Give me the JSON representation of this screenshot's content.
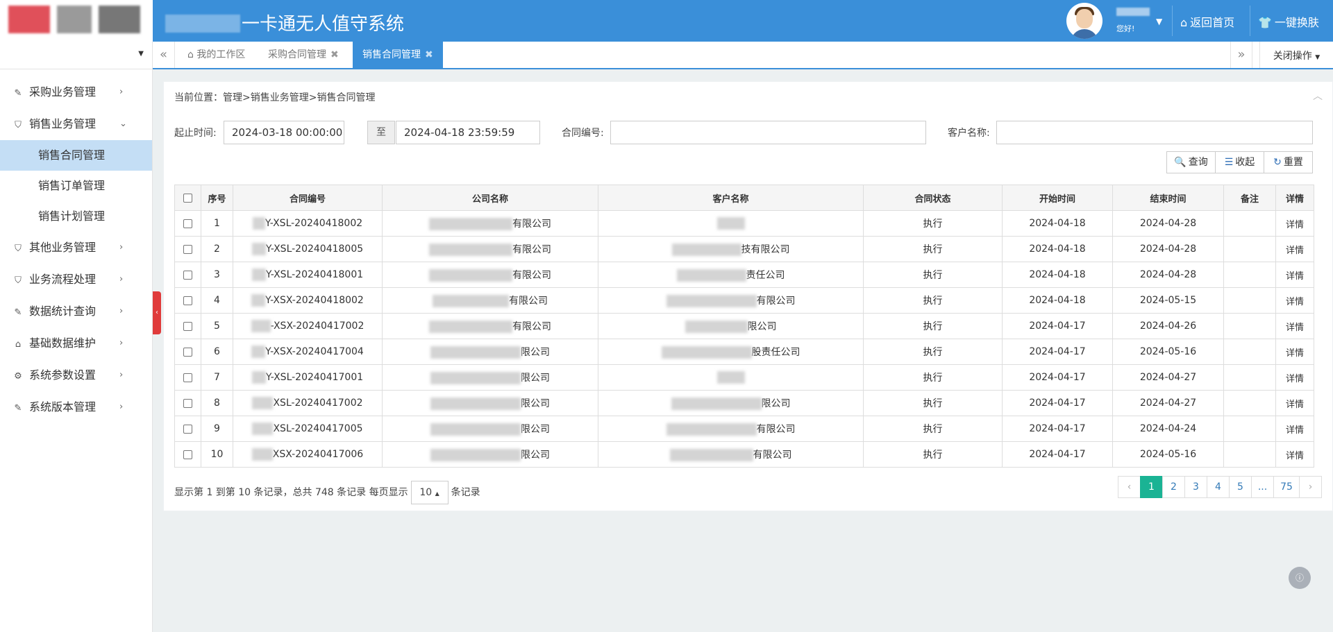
{
  "header": {
    "title": "一卡通无人值守系统",
    "greeting": "您好!",
    "home_link": "返回首页",
    "skin_link": "一键换肤"
  },
  "tabs": {
    "items": [
      {
        "label": "我的工作区",
        "active": false,
        "closable": false
      },
      {
        "label": "采购合同管理",
        "active": false,
        "closable": true
      },
      {
        "label": "销售合同管理",
        "active": true,
        "closable": true
      }
    ],
    "close_ops": "关闭操作"
  },
  "sidebar": {
    "items": [
      {
        "label": "采购业务管理",
        "icon": "edit-icon"
      },
      {
        "label": "销售业务管理",
        "icon": "shield-icon",
        "expanded": true,
        "children": [
          {
            "label": "销售合同管理",
            "active": true
          },
          {
            "label": "销售订单管理"
          },
          {
            "label": "销售计划管理"
          }
        ]
      },
      {
        "label": "其他业务管理",
        "icon": "shield-icon"
      },
      {
        "label": "业务流程处理",
        "icon": "shield-icon"
      },
      {
        "label": "数据统计查询",
        "icon": "edit-icon"
      },
      {
        "label": "基础数据维护",
        "icon": "home-icon"
      },
      {
        "label": "系统参数设置",
        "icon": "gear-icon"
      },
      {
        "label": "系统版本管理",
        "icon": "edit-icon"
      }
    ]
  },
  "breadcrumb": "当前位置：管理>销售业务管理>销售合同管理",
  "filters": {
    "time_label": "起止时间:",
    "start_time": "2024-03-18 00:00:00",
    "to": "至",
    "end_time": "2024-04-18 23:59:59",
    "contract_no_label": "合同编号:",
    "contract_no_value": "",
    "customer_label": "客户名称:",
    "customer_value": ""
  },
  "buttons": {
    "query": "查询",
    "collapse": "收起",
    "reset": "重置"
  },
  "table": {
    "columns": [
      "序号",
      "合同编号",
      "公司名称",
      "客户名称",
      "合同状态",
      "开始时间",
      "结束时间",
      "备注",
      "详情"
    ],
    "rows": [
      {
        "no": "1",
        "contract": "Y-XSL-20240418002",
        "company": "有限公司",
        "customer": "",
        "status": "执行",
        "start": "2024-04-18",
        "end": "2024-04-28",
        "remark": "",
        "detail": "详情"
      },
      {
        "no": "2",
        "contract": "Y-XSL-20240418005",
        "company": "有限公司",
        "customer": "技有限公司",
        "status": "执行",
        "start": "2024-04-18",
        "end": "2024-04-28",
        "remark": "",
        "detail": "详情"
      },
      {
        "no": "3",
        "contract": "Y-XSL-20240418001",
        "company": "有限公司",
        "customer": "责任公司",
        "status": "执行",
        "start": "2024-04-18",
        "end": "2024-04-28",
        "remark": "",
        "detail": "详情"
      },
      {
        "no": "4",
        "contract": "Y-XSX-20240418002",
        "company": "有限公司",
        "customer": "有限公司",
        "status": "执行",
        "start": "2024-04-18",
        "end": "2024-05-15",
        "remark": "",
        "detail": "详情"
      },
      {
        "no": "5",
        "contract": "-XSX-20240417002",
        "company": "有限公司",
        "customer": "限公司",
        "status": "执行",
        "start": "2024-04-17",
        "end": "2024-04-26",
        "remark": "",
        "detail": "详情"
      },
      {
        "no": "6",
        "contract": "Y-XSX-20240417004",
        "company": "限公司",
        "customer": "股责任公司",
        "status": "执行",
        "start": "2024-04-17",
        "end": "2024-05-16",
        "remark": "",
        "detail": "详情"
      },
      {
        "no": "7",
        "contract": "Y-XSL-20240417001",
        "company": "限公司",
        "customer": "",
        "status": "执行",
        "start": "2024-04-17",
        "end": "2024-04-27",
        "remark": "",
        "detail": "详情"
      },
      {
        "no": "8",
        "contract": "XSL-20240417002",
        "company": "限公司",
        "customer": "限公司",
        "status": "执行",
        "start": "2024-04-17",
        "end": "2024-04-27",
        "remark": "",
        "detail": "详情"
      },
      {
        "no": "9",
        "contract": "XSL-20240417005",
        "company": "限公司",
        "customer": "有限公司",
        "status": "执行",
        "start": "2024-04-17",
        "end": "2024-04-24",
        "remark": "",
        "detail": "详情"
      },
      {
        "no": "10",
        "contract": "XSX-20240417006",
        "company": "限公司",
        "customer": "有限公司",
        "status": "执行",
        "start": "2024-04-17",
        "end": "2024-05-16",
        "remark": "",
        "detail": "详情"
      }
    ]
  },
  "pagination": {
    "info_prefix": "显示第 1 到第 10 条记录，总共 748 条记录 每页显示",
    "page_size": "10",
    "info_suffix": "条记录",
    "prev": "‹",
    "next": "›",
    "pages": [
      "1",
      "2",
      "3",
      "4",
      "5",
      "...",
      "75"
    ],
    "active_page": "1"
  },
  "colors": {
    "header_blue": "#3a8fd9",
    "active_page": "#1ab394",
    "collapse_tab": "#e03b3b",
    "submenu_active": "#c4def5"
  }
}
